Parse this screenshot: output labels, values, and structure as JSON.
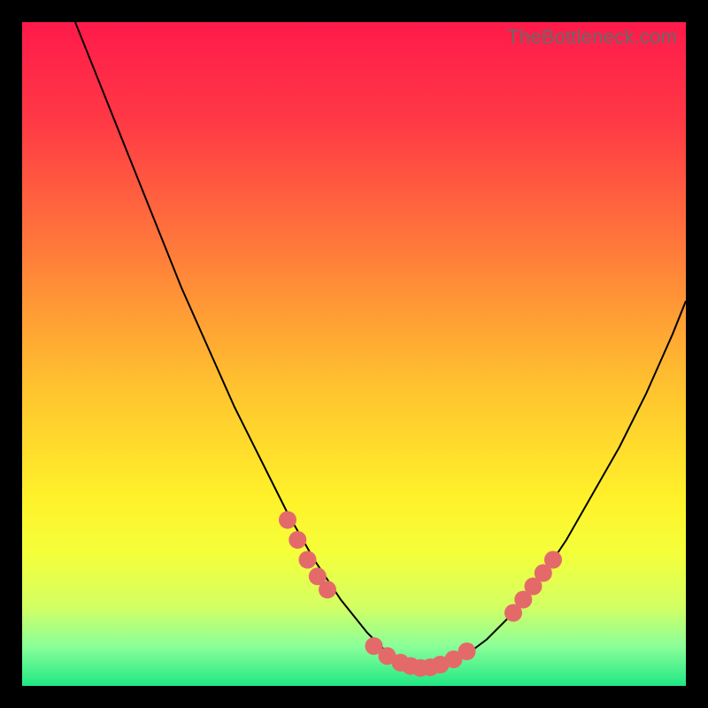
{
  "watermark": "TheBottleneck.com",
  "chart_data": {
    "type": "line",
    "title": "",
    "xlabel": "",
    "ylabel": "",
    "xlim": [
      0,
      100
    ],
    "ylim": [
      0,
      100
    ],
    "grid": false,
    "legend": false,
    "gradient_stops": [
      {
        "offset": 0,
        "color": "#ff1a4b"
      },
      {
        "offset": 15,
        "color": "#ff3945"
      },
      {
        "offset": 35,
        "color": "#ff7d3a"
      },
      {
        "offset": 55,
        "color": "#ffc32f"
      },
      {
        "offset": 72,
        "color": "#fff22a"
      },
      {
        "offset": 80,
        "color": "#f4ff3a"
      },
      {
        "offset": 88,
        "color": "#d4ff63"
      },
      {
        "offset": 94,
        "color": "#8bff99"
      },
      {
        "offset": 100,
        "color": "#20e884"
      }
    ],
    "series": [
      {
        "name": "curve",
        "color": "#000000",
        "x": [
          8,
          12,
          16,
          20,
          24,
          28,
          32,
          36,
          40,
          44,
          48,
          52,
          56,
          58,
          60,
          62,
          66,
          70,
          74,
          78,
          82,
          86,
          90,
          94,
          98,
          100
        ],
        "y": [
          100,
          90,
          80,
          70,
          60,
          51,
          42,
          34,
          26,
          19,
          13,
          8,
          4,
          3,
          2.5,
          2.7,
          4,
          7,
          11,
          16,
          22,
          29,
          36,
          44,
          53,
          58
        ]
      }
    ],
    "marker_clusters": [
      {
        "name": "left-cluster",
        "color": "#e46a6a",
        "x": [
          40,
          41.5,
          43,
          44.5,
          46
        ],
        "y": [
          25,
          22,
          19,
          16.5,
          14.5
        ]
      },
      {
        "name": "bottom-cluster",
        "color": "#e46a6a",
        "x": [
          53,
          55,
          57,
          58.5,
          60,
          61.5,
          63,
          65,
          67
        ],
        "y": [
          6,
          4.5,
          3.5,
          3,
          2.7,
          2.8,
          3.2,
          4,
          5.2
        ]
      },
      {
        "name": "right-cluster",
        "color": "#e46a6a",
        "x": [
          74,
          75.5,
          77,
          78.5,
          80
        ],
        "y": [
          11,
          13,
          15,
          17,
          19
        ]
      }
    ]
  }
}
